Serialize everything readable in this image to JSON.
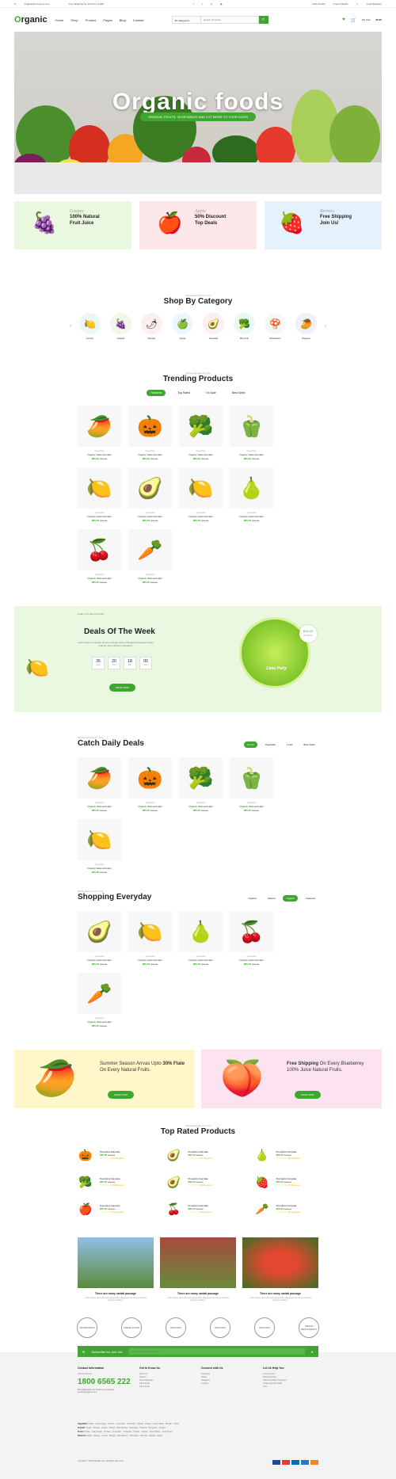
{
  "topbar": {
    "email": "Organic@company.com",
    "shipping": "Free Shipping for all Order of $99",
    "currency": "USD (Dollar)",
    "language": "French (EUR)",
    "account": "Login/Register"
  },
  "header": {
    "logo_o": "O",
    "logo_rest": "rganic",
    "nav": [
      "Home",
      "Shop",
      "Product",
      "Pages",
      "Blog",
      "Contact"
    ],
    "search_cat": "All Categories",
    "search_placeholder": "Search products...",
    "cart_label": "My Cart",
    "cart_total": "$0.00"
  },
  "hero": {
    "title": "Organic foods",
    "ribbon": "ORGANIC FRUITS, VEGETABLES AND LOT MORE TO YOUR DOOR"
  },
  "promos": [
    {
      "name": "Grapes",
      "line1": "100% Natural",
      "line2": "Fruit Juice",
      "bg": "#e9f8df"
    },
    {
      "name": "Apple",
      "line1": "50% Discount",
      "line2": "Top Deals",
      "bg": "#fde7e8"
    },
    {
      "name": "Berries",
      "line1": "Free Shipping",
      "line2": "Join Us!",
      "bg": "#e3f2fd"
    }
  ],
  "shopcat": {
    "sub": "All the best item for You",
    "title": "Shop By Category",
    "items": [
      "Lemon",
      "Grapes",
      "Pepper",
      "Apple",
      "Avocado",
      "Broccoli",
      "Mushroom",
      "Papaya"
    ]
  },
  "trending": {
    "sub": "All the best item for You",
    "title": "Trending Products",
    "tabs": [
      "Featured",
      "Top Rated",
      "On Sale",
      "Best Seller"
    ]
  },
  "product": {
    "category": "Vegetables",
    "name": "Organic Hass Avocado",
    "price": "$85.00",
    "old": "$95.00"
  },
  "deal": {
    "sub": "Lisah con't flow on Fruits",
    "title": "Deals Of The Week",
    "text": "Lorem Ipsum is simply dummy texting of the printings and typesed when industry has industry's standard.",
    "countdown": [
      {
        "v": "35",
        "l": "Days"
      },
      {
        "v": "20",
        "l": "Hrs"
      },
      {
        "v": "18",
        "l": "Min"
      },
      {
        "v": "00",
        "l": "Sec"
      }
    ],
    "button": "SHOP NOW",
    "badge_price": "$19.00",
    "badge_sub": "Per Bottle",
    "lime": "Lime Party"
  },
  "daily": {
    "sub": "All the best item for You",
    "title": "Catch Daily Deals",
    "tabs": [
      "Top 20",
      "Vegetable",
      "Fruits",
      "Best Seller"
    ]
  },
  "everyday": {
    "sub": "All the best item for You",
    "title": "Shopping Everyday",
    "tabs": [
      "Organic",
      "Natural",
      "Organic",
      "Featured"
    ]
  },
  "banners": [
    {
      "t1": "Summer Season Arrvas Upto ",
      "strong": "30% Flate",
      "t2": " On Every Natural Fruits.",
      "button": "SHOP NOW",
      "bg": "#fff6c9"
    },
    {
      "strong": "Free Shipping",
      "t1": " On Every Blueberrey 100% Juice Natural Fruits.",
      "t2": "",
      "button": "SHOP NOW",
      "bg": "#fde3ef"
    }
  ],
  "toprated": {
    "sub": "All the best item for You",
    "title": "Top Rated Products",
    "item_name": "Pumpkins Fairytale",
    "price": "$85.00",
    "old": "$95.00",
    "stars": "☆☆☆☆☆ (25 Review)"
  },
  "blog": {
    "date": "26 DEC",
    "title": "There are many variati passage",
    "body": "Lorem ipsum dolor sit amet consectetur adipiscing elit sed do eiusmod tempor incididunt."
  },
  "brands": [
    "VEGETARIAN",
    "FRESH FOOD",
    "ORGANIC",
    "ORGANIC",
    "ORGANIC",
    "VEGAN RESTAURANT"
  ],
  "footer": {
    "subscribe": "Subscribe for Join Us!",
    "sub_placeholder": "Subscribe to our newsletter",
    "contact_title": "Contact Information",
    "call_label": "Call Us Us Free",
    "phone": "1800 6565 222",
    "address": "562 Wallingdale Ter, Melbourne, Australia",
    "contact_email": "contact@organic.com",
    "cols": [
      {
        "title": "Get to Know Us",
        "items": [
          "About Us",
          "Careers",
          "Press Releases",
          "Gift a Smile",
          "Gift a Smile"
        ]
      },
      {
        "title": "Connect with Us",
        "items": [
          "Facebook",
          "Twitter",
          "Instagram",
          "Youtube"
        ]
      },
      {
        "title": "Let Us Help You",
        "items": [
          "Your Account",
          "Returns Centre",
          "100% Purchase Protection",
          "Cooke App Download",
          "Help"
        ]
      }
    ],
    "tags": [
      {
        "k": "Vegetable:",
        "v": "Potato · Lady Finger · Tomato · Cucumber · Coriander · Flower · Pepper · Green Bean · Bengle · Onion"
      },
      {
        "k": "Organic:",
        "v": "Apple · Orange · Guava · Mango · Blue Berries · Pineapple · Banana · Peregrant · Grapes"
      },
      {
        "k": "Fruits:",
        "v": "Potato · Lady Finger · Tomato · Cucumber · Coriander · Flower · Pepper · Green Bean · Lady Finger"
      },
      {
        "k": "Naturals:",
        "v": "Apple · Orange · Guava · Mango · Blue Berries · Pineapple · Banana · Orange · Apple"
      }
    ],
    "copyright": "Copyright © 2018 Satellite.com. All Rights Reserved."
  }
}
